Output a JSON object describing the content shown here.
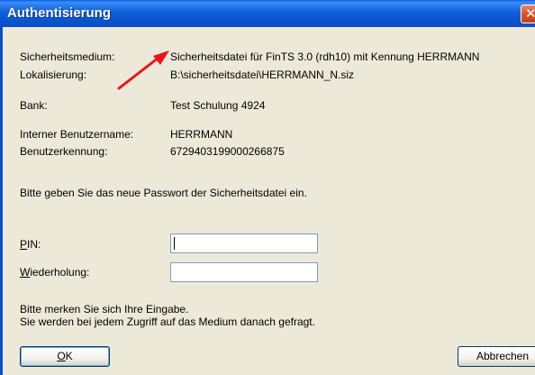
{
  "window": {
    "title": "Authentisierung"
  },
  "info": {
    "medium_label": "Sicherheitsmedium:",
    "medium_value": "Sicherheitsdatei für FinTS 3.0 (rdh10) mit Kennung HERRMANN",
    "location_label": "Lokalisierung:",
    "location_value": "B:\\sicherheitsdatei\\HERRMANN_N.siz",
    "bank_label": "Bank:",
    "bank_value": "Test Schulung 4924",
    "internal_user_label": "Interner Benutzername:",
    "internal_user_value": "HERRMANN",
    "user_id_label": "Benutzerkennung:",
    "user_id_value": "6729403199000266875"
  },
  "prompt": {
    "text": "Bitte geben Sie das neue Passwort der Sicherheitsdatei ein."
  },
  "form": {
    "pin_label_accel": "P",
    "pin_label_rest": "IN:",
    "pin_value": "",
    "repeat_label_accel": "W",
    "repeat_label_rest": "iederholung:",
    "repeat_value": ""
  },
  "notice": {
    "line1": "Bitte merken Sie sich Ihre Eingabe.",
    "line2": "Sie werden bei jedem Zugriff auf das Medium danach gefragt."
  },
  "buttons": {
    "ok_accel": "O",
    "ok_rest": "K",
    "cancel_label": "Abbrechen"
  },
  "colors": {
    "titlebar": "#0a5fe0",
    "dialog_bg": "#ece9d8",
    "arrow": "#e8141c",
    "close_button": "#d9542b"
  },
  "icons": {
    "close": "close-icon",
    "annotation": "red-arrow-icon"
  }
}
